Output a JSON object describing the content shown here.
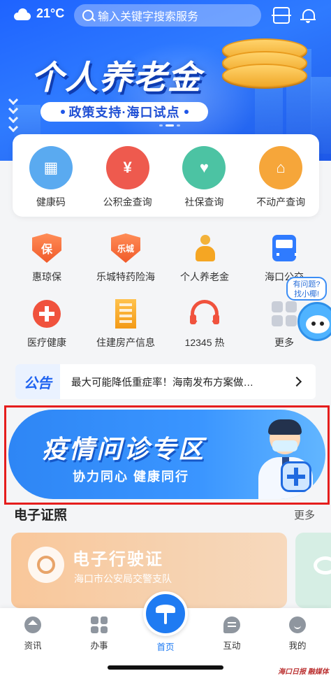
{
  "status_bar": {
    "temperature": "21°C"
  },
  "search": {
    "placeholder": "输入关键字搜索服务"
  },
  "hero": {
    "title": "个人养老金",
    "subtitle": "政策支持·海口试点"
  },
  "quick_services": [
    {
      "label": "健康码",
      "icon": "health-code-icon",
      "color": "#5aaaf0"
    },
    {
      "label": "公积金查询",
      "icon": "housing-fund-icon",
      "color": "#ee5a4e"
    },
    {
      "label": "社保查询",
      "icon": "social-security-icon",
      "color": "#4cc3a3"
    },
    {
      "label": "不动产查询",
      "icon": "real-estate-icon",
      "color": "#f6a63a"
    }
  ],
  "services": [
    {
      "label": "惠琼保",
      "icon": "shield-icon",
      "badge": "保"
    },
    {
      "label": "乐城特药险海",
      "icon": "shield-icon",
      "badge": "乐城"
    },
    {
      "label": "个人养老金",
      "icon": "person-icon"
    },
    {
      "label": "海口公交",
      "icon": "bus-icon"
    },
    {
      "label": "医疗健康",
      "icon": "medical-plus-icon"
    },
    {
      "label": "住建房产信息",
      "icon": "building-icon"
    },
    {
      "label": "12345 热",
      "icon": "hotline-headset-icon"
    },
    {
      "label": "更多",
      "icon": "more-grid-icon"
    }
  ],
  "mascot": {
    "line1": "有问题?",
    "line2": "找小椰!"
  },
  "notice": {
    "tag": "公告",
    "text": "最大可能降低重症率！海南发布方案做…"
  },
  "epidemic_banner": {
    "title": "疫情问诊专区",
    "subtitle": "协力同心  健康同行",
    "highlight_color": "#e51d1d"
  },
  "section": {
    "title": "电子证照",
    "more": "更多"
  },
  "license_card": {
    "title": "电子行驶证",
    "subtitle": "海口市公安局交警支队"
  },
  "tabbar": {
    "tabs": [
      {
        "label": "资讯",
        "icon": "news-compass-icon"
      },
      {
        "label": "办事",
        "icon": "services-grid-icon"
      },
      {
        "label": "首页",
        "icon": "palm-tree-home-icon",
        "active": true
      },
      {
        "label": "互动",
        "icon": "chat-bubble-icon"
      },
      {
        "label": "我的",
        "icon": "profile-smile-icon"
      }
    ]
  },
  "watermark": "海口日报 融媒体",
  "colors": {
    "primary": "#1f7bf2",
    "notice_tag": "#1f63f0"
  }
}
